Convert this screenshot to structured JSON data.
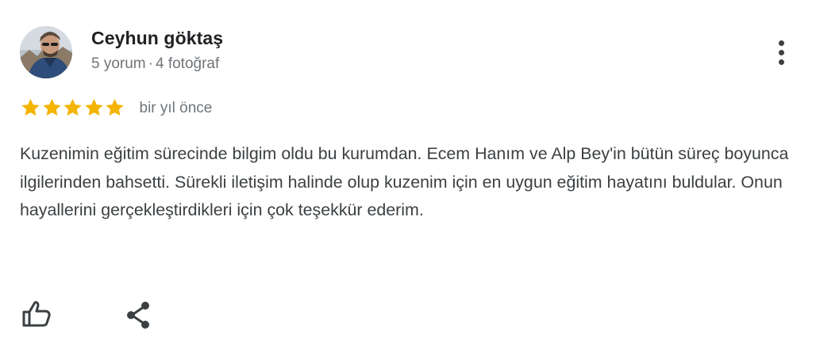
{
  "review": {
    "author": {
      "name": "Ceyhun göktaş",
      "review_count": "5 yorum",
      "separator": "·",
      "photo_count": "4 fotoğraf"
    },
    "rating": 5,
    "rating_max": 5,
    "date": "bir yıl önce",
    "text": "Kuzenimin eğitim sürecinde bilgim oldu bu kurumdan. Ecem Hanım ve Alp Bey'in bütün süreç boyunca ilgilerinden bahsetti. Sürekli iletişim halinde olup kuzenim için en uygun eğitim hayatını buldular. Onun hayallerini gerçekleştirdikleri için çok teşekkür ederim."
  },
  "icons": {
    "more": "more-vert-icon",
    "star": "star-icon",
    "like": "thumb-up-icon",
    "share": "share-icon"
  },
  "colors": {
    "star": "#f4b400",
    "name": "#202124",
    "meta": "#70757a",
    "body": "#3c4043",
    "icon": "#3c4043"
  }
}
